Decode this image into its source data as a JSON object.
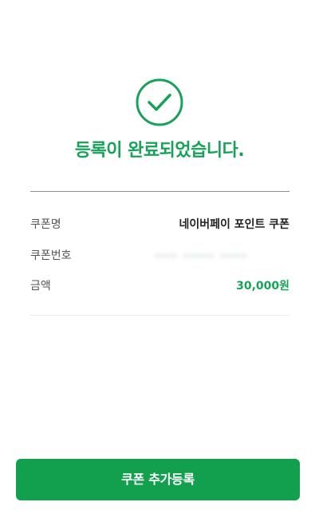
{
  "result": {
    "icon": "check-circle-icon",
    "title": "등록이 완료되었습니다."
  },
  "details": {
    "rows": [
      {
        "label": "쿠폰명",
        "value": "네이버페이 포인트 쿠폰"
      },
      {
        "label": "쿠폰번호",
        "value": ""
      },
      {
        "label": "금액",
        "value": "30,000원"
      }
    ]
  },
  "footer": {
    "add_button_label": "쿠폰 추가등록"
  },
  "colors": {
    "accent": "#17a25a",
    "button": "#13a04e"
  }
}
